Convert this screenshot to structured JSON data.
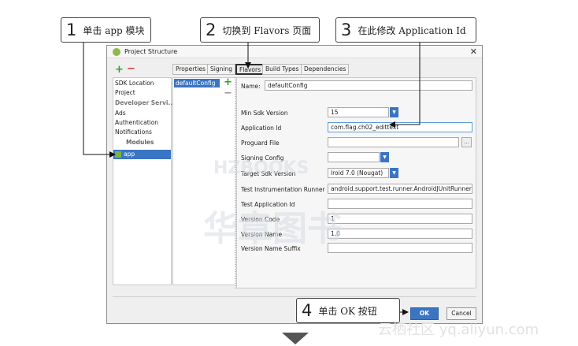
{
  "callouts": {
    "c1": {
      "num": "1",
      "text": "单击 app 模块"
    },
    "c2": {
      "num": "2",
      "text": "切换到 Flavors 页面"
    },
    "c3": {
      "num": "3",
      "text": "在此修改 Application Id"
    },
    "c4": {
      "num": "4",
      "text": "单击 OK 按钮"
    }
  },
  "dialog": {
    "title": "Project Structure",
    "close_glyph": "✕"
  },
  "left_panel": {
    "add": "+",
    "remove": "−",
    "items": [
      "SDK Location",
      "Project"
    ],
    "dev_header": "Developer Servi...",
    "services": [
      "Ads",
      "Authentication",
      "Notifications"
    ],
    "modules_header": "Modules",
    "module_selected": "app"
  },
  "tabs": [
    "Properties",
    "Signing",
    "Flavors",
    "Build Types",
    "Dependencies"
  ],
  "config_list": {
    "selected": "defaultConfig",
    "add": "+",
    "remove": "−"
  },
  "form": {
    "name_label": "Name:",
    "name_value": "defaultConfig",
    "min_sdk_label": "Min Sdk Version",
    "min_sdk_value": "15",
    "app_id_label": "Application Id",
    "app_id_value": "com.flag.ch02_edittext",
    "proguard_label": "Proguard File",
    "proguard_value": "",
    "browse": "...",
    "signing_label": "Signing Config",
    "signing_value": "",
    "target_sdk_label": "Target Sdk Version",
    "target_sdk_value": "lroid 7.0 (Nougat)",
    "test_runner_label": "Test Instrumentation Runner",
    "test_runner_value": "android.support.test.runner.AndroidJUnitRunner",
    "test_app_id_label": "Test Application Id",
    "test_app_id_value": "",
    "version_code_label": "Version Code",
    "version_code_value": "1",
    "version_name_label": "Version Name",
    "version_name_value": "1.0",
    "version_suffix_label": "Version Name Suffix",
    "version_suffix_value": "",
    "dropdown_glyph": "▼"
  },
  "buttons": {
    "ok": "OK",
    "cancel": "Cancel"
  },
  "watermark": {
    "big": "华章图书",
    "small": "HZBOOKS",
    "footer": "云栖社区 yq.aliyun.com"
  },
  "colors": {
    "accent": "#3a75c4",
    "add": "#2aa52a",
    "remove": "#d03b3b"
  }
}
